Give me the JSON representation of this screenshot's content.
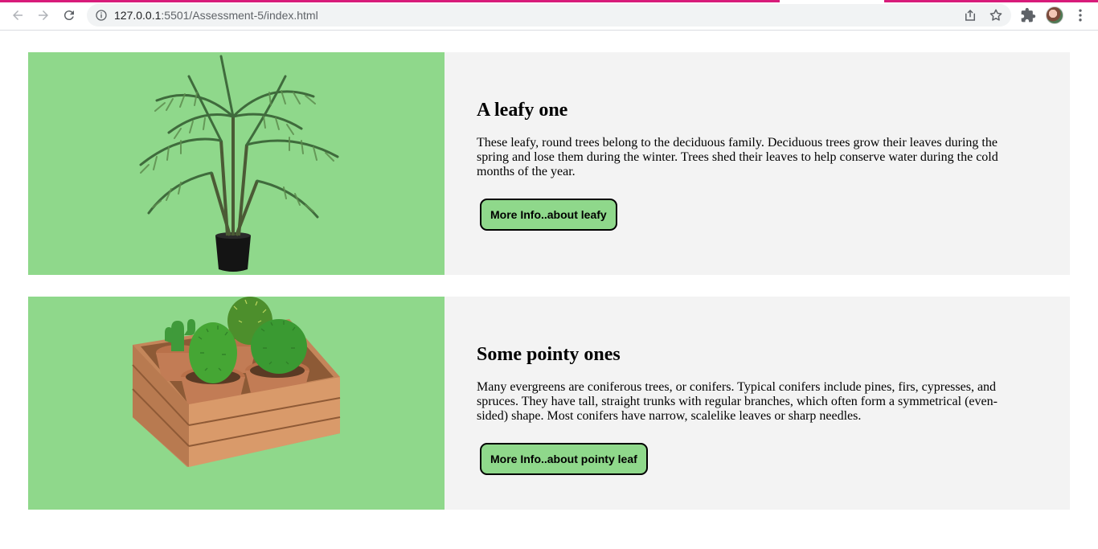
{
  "browser": {
    "url_host": "127.0.0.1",
    "url_rest": ":5501/Assessment-5/index.html",
    "icons": [
      "back-icon",
      "forward-icon",
      "reload-icon",
      "info-icon",
      "share-icon",
      "star-icon",
      "extensions-icon",
      "avatar",
      "menu-icon"
    ]
  },
  "cards": [
    {
      "title": "A leafy one",
      "description": "These leafy, round trees belong to the deciduous family. Deciduous trees grow their leaves during the spring and lose them during the winter. Trees shed their leaves to help conserve water during the cold months of the year.",
      "button_label": "More Info..about leafy",
      "image": "potted-palm-plant"
    },
    {
      "title": "Some pointy ones",
      "description": "Many evergreens are coniferous trees, or conifers. Typical conifers include pines, firs, cypresses, and spruces. They have tall, straight trunks with regular branches, which often form a symmetrical (even-sided) shape. Most conifers have narrow, scalelike leaves or sharp needles.",
      "button_label": "More Info..about pointy leaf",
      "image": "cacti-in-wooden-crate"
    }
  ],
  "colors": {
    "accent_green": "#8fd88b",
    "panel_gray": "#f3f3f3",
    "tab_accent": "#d81b7a"
  }
}
